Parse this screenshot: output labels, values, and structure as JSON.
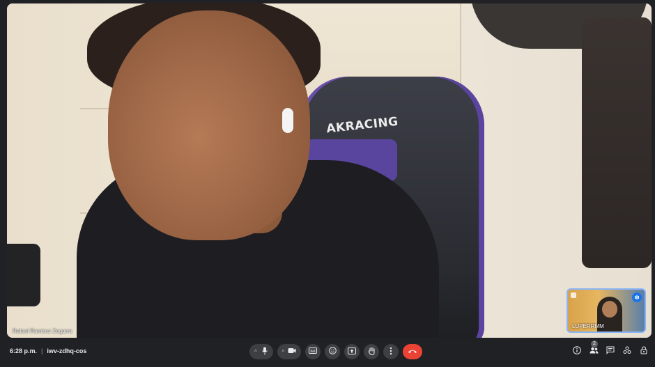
{
  "main_participant": {
    "name": "Rafael Ramirez Zegarra",
    "chair_brand": "AKRACING"
  },
  "self_view": {
    "label": "LUPERRMM"
  },
  "meeting": {
    "time": "6:28 p.m.",
    "separator": "|",
    "code": "iwv-zdhq-cos"
  },
  "controls": {
    "mic": {
      "icon": "mic-icon",
      "menu_icon": "chevron-up-icon"
    },
    "camera": {
      "icon": "camera-icon",
      "menu_icon": "chevron-up-icon"
    },
    "captions": {
      "icon": "captions-icon"
    },
    "emoji": {
      "icon": "emoji-icon"
    },
    "present": {
      "icon": "present-screen-icon"
    },
    "raise_hand": {
      "icon": "raise-hand-icon"
    },
    "more": {
      "icon": "more-vert-icon"
    },
    "end_call": {
      "icon": "end-call-icon",
      "color": "#ea4335"
    }
  },
  "right_controls": {
    "info": {
      "icon": "info-icon"
    },
    "people": {
      "icon": "people-icon",
      "count": "2"
    },
    "chat": {
      "icon": "chat-icon"
    },
    "activities": {
      "icon": "activities-icon"
    },
    "host_controls": {
      "icon": "lock-person-icon"
    }
  },
  "colors": {
    "background": "#202124",
    "accent": "#8ab4f8",
    "end_call": "#ea4335",
    "button": "#3c4043"
  }
}
